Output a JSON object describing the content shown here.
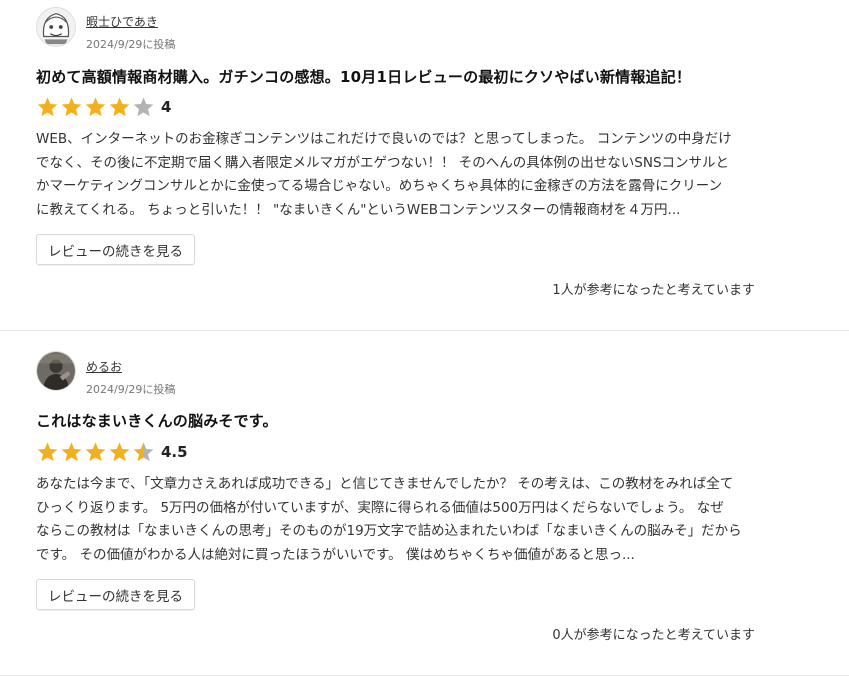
{
  "colors": {
    "star_filled": "#f2b01e",
    "star_empty": "#b3b3b3",
    "divider": "#e6e6e6"
  },
  "reviews": [
    {
      "avatar_icon": "cartoon-face-avatar",
      "reviewer_name": "暇士ひであき",
      "posted_date": "2024/9/29に投稿",
      "title": "初めて高額情報商材購入。ガチンコの感想。10月1日レビューの最初にクソやばい新情報追記！",
      "rating": 4,
      "rating_label": "4",
      "body_lines": [
        "WEB、インターネットのお金稼ぎコンテンツはこれだけで良いのでは？と思ってしまった。 コンテンツの中身だけ",
        "でなく、その後に不定期で届く購入者限定メルマガがエゲつない！！ そのへんの具体例の出せないSNSコンサルと",
        "かマーケティングコンサルとかに金使ってる場合じゃない。めちゃくちゃ具体的に金稼ぎの方法を露骨にクリーン",
        "に教えてくれる。 ちょっと引いた！！ \"なまいきくん\"というWEBコンテンツスターの情報商材を４万円..."
      ],
      "more_button_label": "レビューの続きを見る",
      "helpful_text": "1人が参考になったと考えています"
    },
    {
      "avatar_icon": "dark-person-avatar",
      "reviewer_name": "めるお",
      "posted_date": "2024/9/29に投稿",
      "title": "これはなまいきくんの脳みそです。",
      "rating": 4.5,
      "rating_label": "4.5",
      "body_lines": [
        "あなたは今まで、「文章力さえあれば成功できる」と信じてきませんでしたか？ その考えは、この教材をみれば全て",
        "ひっくり返ります。 5万円の価格が付いていますが、実際に得られる価値は500万円はくだらないでしょう。 なぜ",
        "ならこの教材は「なまいきくんの思考」そのものが19万文字で詰め込まれたいわば「なまいきくんの脳みそ」だから",
        "です。 その価値がわかる人は絶対に買ったほうがいいです。 僕はめちゃくちゃ価値があると思っ..."
      ],
      "more_button_label": "レビューの続きを見る",
      "helpful_text": "0人が参考になったと考えています"
    }
  ]
}
